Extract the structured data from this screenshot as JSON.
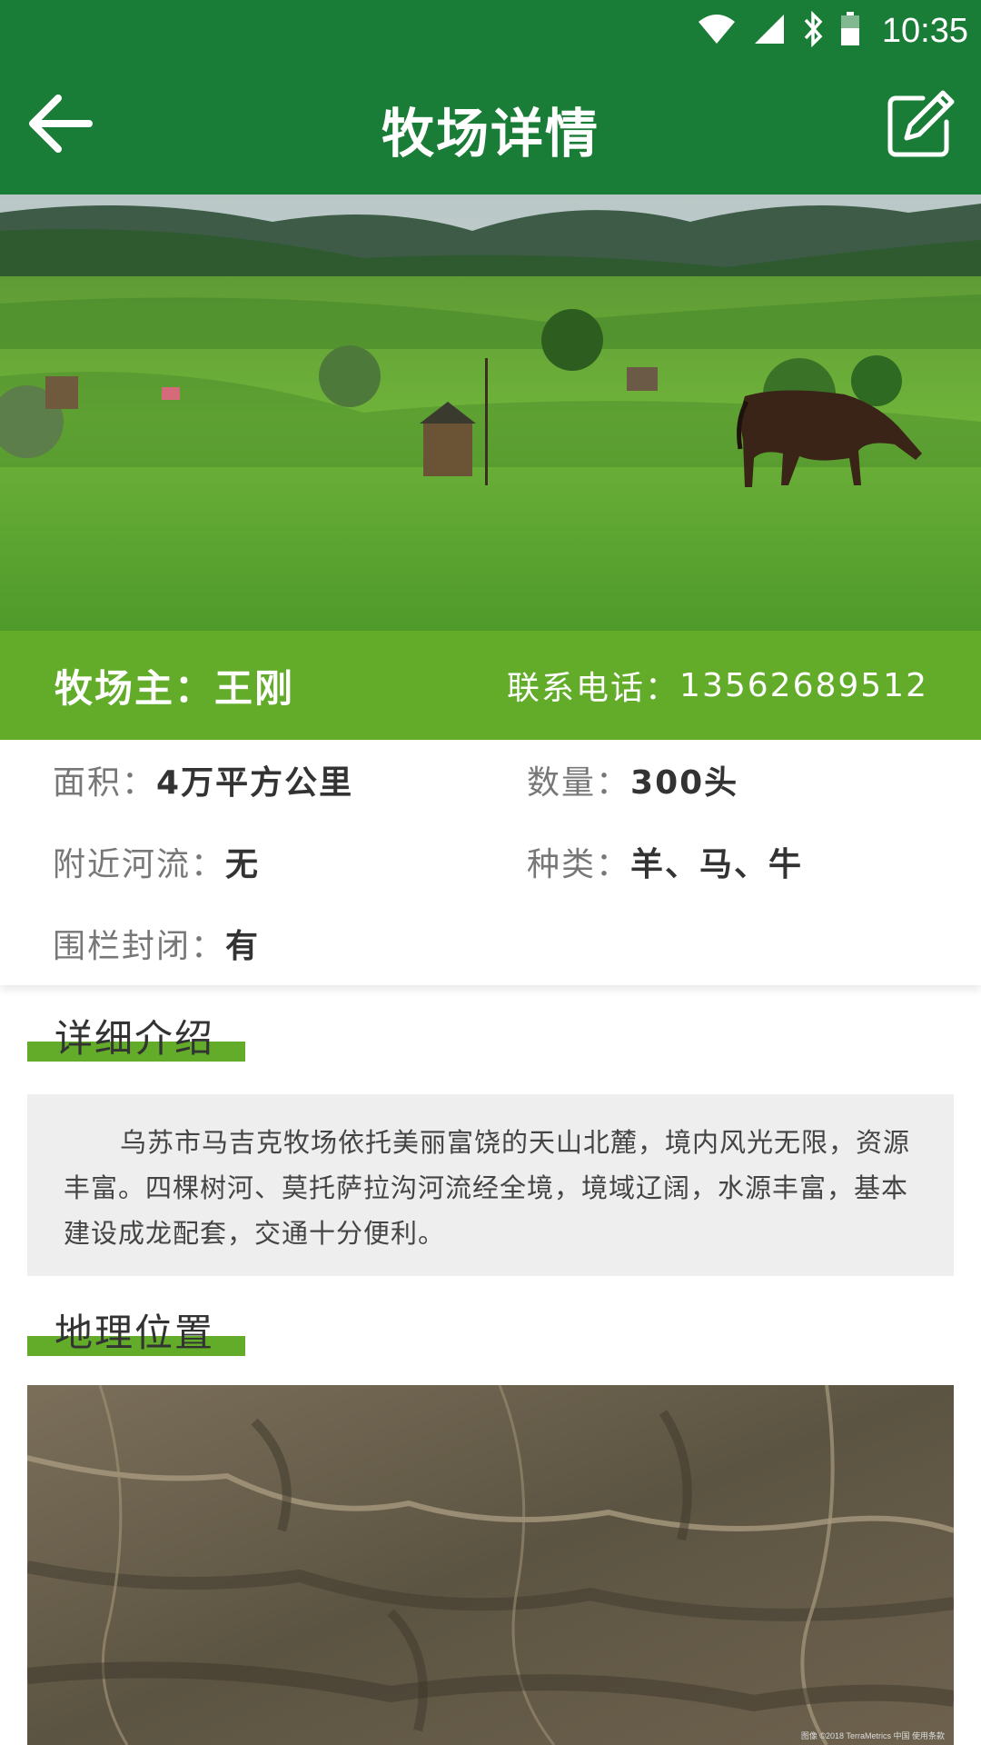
{
  "status_bar": {
    "time": "10:35"
  },
  "header": {
    "title": "牧场详情"
  },
  "owner_band": {
    "owner_label": "牧场主：",
    "owner_name": "王刚",
    "phone_label": "联系电话：",
    "phone": "13562689512"
  },
  "info": {
    "area": {
      "label": "面积：",
      "value": "4万平方公里"
    },
    "count": {
      "label": "数量：",
      "value": "300头"
    },
    "river": {
      "label": "附近河流：",
      "value": "无"
    },
    "kinds": {
      "label": "种类：",
      "value": "羊、马、牛"
    },
    "fence": {
      "label": "围栏封闭：",
      "value": "有"
    }
  },
  "detail": {
    "heading": "详细介绍",
    "text": "乌苏市马吉克牧场依托美丽富饶的天山北麓，境内风光无限，资源丰富。四棵树河、莫托萨拉沟河流经全境，境域辽阔，水源丰富，基本建设成龙配套，交通十分便利。"
  },
  "location": {
    "heading": "地理位置",
    "credit": "图像 ©2018 TerraMetrics   中国   使用条款"
  },
  "colors": {
    "primary_dark": "#1a7d37",
    "accent_green": "#62ac2a",
    "desc_bg": "#eeeeee"
  },
  "icons": [
    "wifi-icon",
    "signal-icon",
    "bluetooth-icon",
    "battery-icon",
    "back-arrow-icon",
    "edit-icon"
  ]
}
